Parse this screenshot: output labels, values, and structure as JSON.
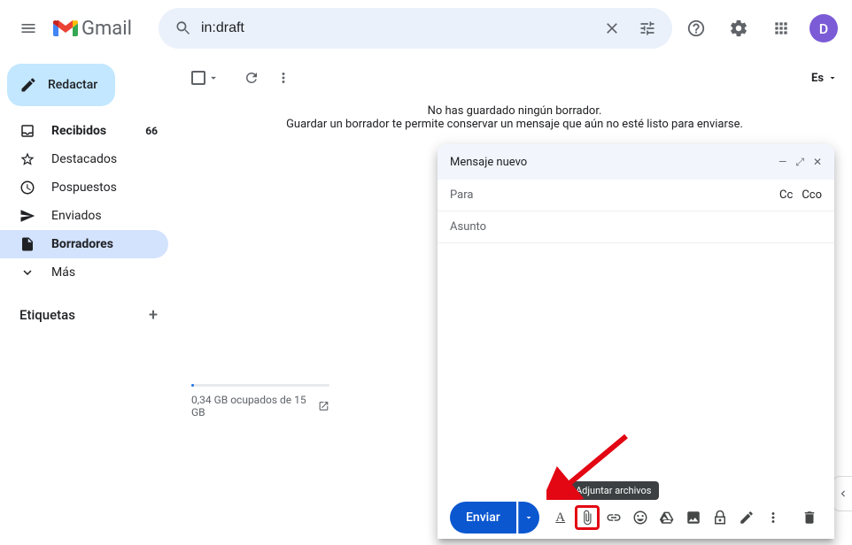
{
  "header": {
    "search_value": "in:draft",
    "avatar_initial": "D"
  },
  "sidebar": {
    "compose_label": "Redactar",
    "items": [
      {
        "label": "Recibidos",
        "count": "66"
      },
      {
        "label": "Destacados"
      },
      {
        "label": "Pospuestos"
      },
      {
        "label": "Enviados"
      },
      {
        "label": "Borradores"
      },
      {
        "label": "Más"
      }
    ],
    "labels_header": "Etiquetas"
  },
  "toolbar": {
    "lang": "Es"
  },
  "empty_state": {
    "line1": "No has guardado ningún borrador.",
    "line2": "Guardar un borrador te permite conservar un mensaje que aún no esté listo para enviarse."
  },
  "storage": {
    "text": "0,34 GB ocupados de 15 GB"
  },
  "compose": {
    "title": "Mensaje nuevo",
    "to_label": "Para",
    "cc_label": "Cc",
    "bcc_label": "Cco",
    "subject_placeholder": "Asunto",
    "send_label": "Enviar",
    "attach_tooltip": "Adjuntar archivos"
  },
  "logo_text": "Gmail"
}
